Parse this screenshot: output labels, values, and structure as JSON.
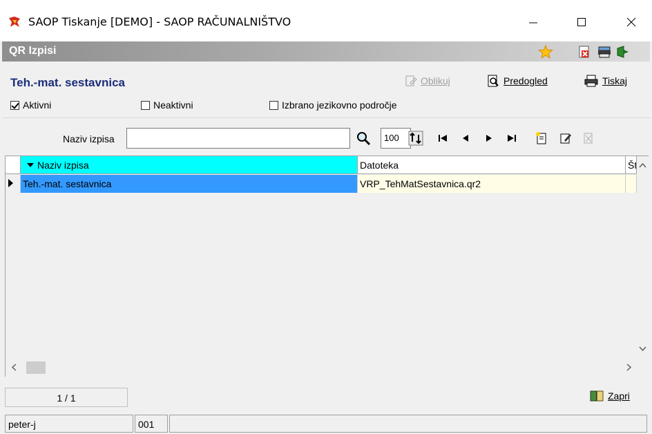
{
  "window": {
    "title": "SAOP Tiskanje [DEMO] - SAOP RAČUNALNIŠTVO"
  },
  "panel": {
    "title": "QR Izpisi",
    "icons": [
      "star-icon",
      "delete-doc-icon",
      "printer-stack-icon",
      "exit-icon"
    ]
  },
  "header": {
    "subtitle": "Teh.-mat. sestavnica",
    "buttons": {
      "oblikuj": "Oblikuj",
      "predogled": "Predogled",
      "tiskaj": "Tiskaj"
    },
    "filters": {
      "aktivni": {
        "label": "Aktivni",
        "checked": true
      },
      "neaktivni": {
        "label": "Neaktivni",
        "checked": false
      },
      "jezik": {
        "label": "Izbrano jezikovno področje",
        "checked": false
      }
    }
  },
  "toolbar": {
    "search_label": "Naziv izpisa",
    "search_value": "",
    "limit": "100"
  },
  "grid": {
    "columns": [
      "Naziv izpisa",
      "Datoteka",
      "Št"
    ],
    "rows": [
      {
        "naziv": "Teh.-mat. sestavnica",
        "datoteka": "VRP_TehMatSestavnica.qr2",
        "st": ""
      }
    ]
  },
  "footer": {
    "counter": "1 / 1",
    "close_label": "Zapri",
    "status": [
      "peter-j",
      "001",
      ""
    ]
  },
  "colors": {
    "accent_cyan": "#00ffff",
    "selected_row": "#3399ff",
    "file_cell": "#fffde6",
    "subtitle": "#1c2d7a"
  }
}
